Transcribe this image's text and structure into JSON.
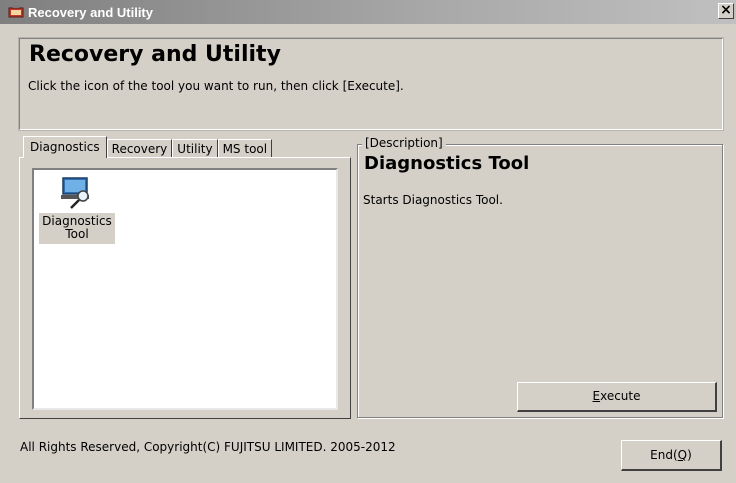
{
  "window": {
    "title": "Recovery and Utility",
    "close_glyph": "×"
  },
  "header": {
    "title": "Recovery and Utility",
    "subtitle": "Click the icon of the tool you want to run, then click [Execute]."
  },
  "tabs": [
    {
      "label": "Diagnostics",
      "active": true
    },
    {
      "label": "Recovery",
      "active": false
    },
    {
      "label": "Utility",
      "active": false
    },
    {
      "label": "MS tool",
      "active": false
    }
  ],
  "tools": [
    {
      "label_line1": "Diagnostics",
      "label_line2": "Tool",
      "icon": "monitor-magnifier-icon",
      "selected": true
    }
  ],
  "description": {
    "legend": "[Description]",
    "title": "Diagnostics Tool",
    "text": "Starts Diagnostics Tool."
  },
  "buttons": {
    "execute_mnemonic": "E",
    "execute_rest": "xecute",
    "end_prefix": "End(",
    "end_mnemonic": "Q",
    "end_suffix": ")"
  },
  "footer": {
    "copyright": "All Rights Reserved, Copyright(C) FUJITSU LIMITED. 2005-2012"
  },
  "colors": {
    "face": "#d4d0c8",
    "titlebar_start": "#7f7f7f",
    "titlebar_end": "#c0c0c0",
    "list_bg": "#ffffff"
  }
}
